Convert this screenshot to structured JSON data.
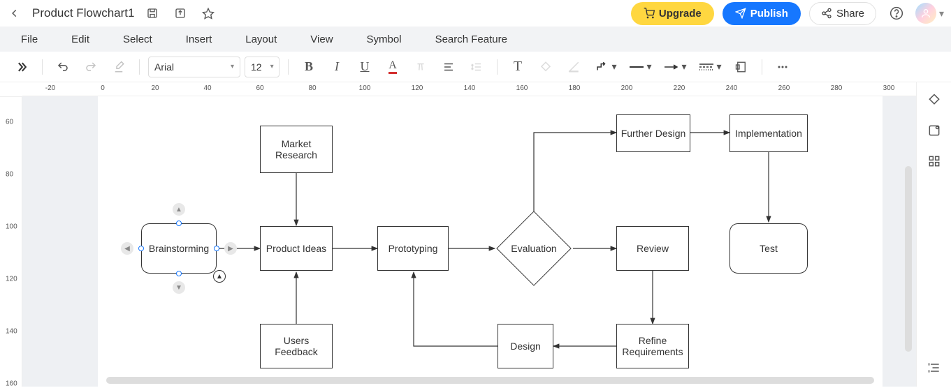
{
  "title": "Product Flowchart1",
  "topbar": {
    "upgrade": "Upgrade",
    "publish": "Publish",
    "share": "Share"
  },
  "menu": {
    "file": "File",
    "edit": "Edit",
    "select": "Select",
    "insert": "Insert",
    "layout": "Layout",
    "view": "View",
    "symbol": "Symbol",
    "search_feature": "Search Feature"
  },
  "toolbar": {
    "font_family": "Arial",
    "font_size": "12"
  },
  "ruler": {
    "h_ticks": [
      "-20",
      "0",
      "20",
      "40",
      "60",
      "80",
      "100",
      "120",
      "140",
      "160",
      "180",
      "200",
      "220",
      "240",
      "260",
      "280",
      "300"
    ],
    "v_ticks": [
      "60",
      "80",
      "100",
      "120",
      "140",
      "160"
    ]
  },
  "diagram": {
    "nodes": {
      "brainstorming": "Brainstorming",
      "market_research": "Market\nResearch",
      "product_ideas": "Product Ideas",
      "prototyping": "Prototyping",
      "evaluation": "Evaluation",
      "further_design": "Further Design",
      "implementation": "Implementation",
      "review": "Review",
      "test": "Test",
      "refine_requirements": "Refine\nRequirements",
      "design": "Design",
      "users_feedback": "Users\nFeedback"
    }
  }
}
